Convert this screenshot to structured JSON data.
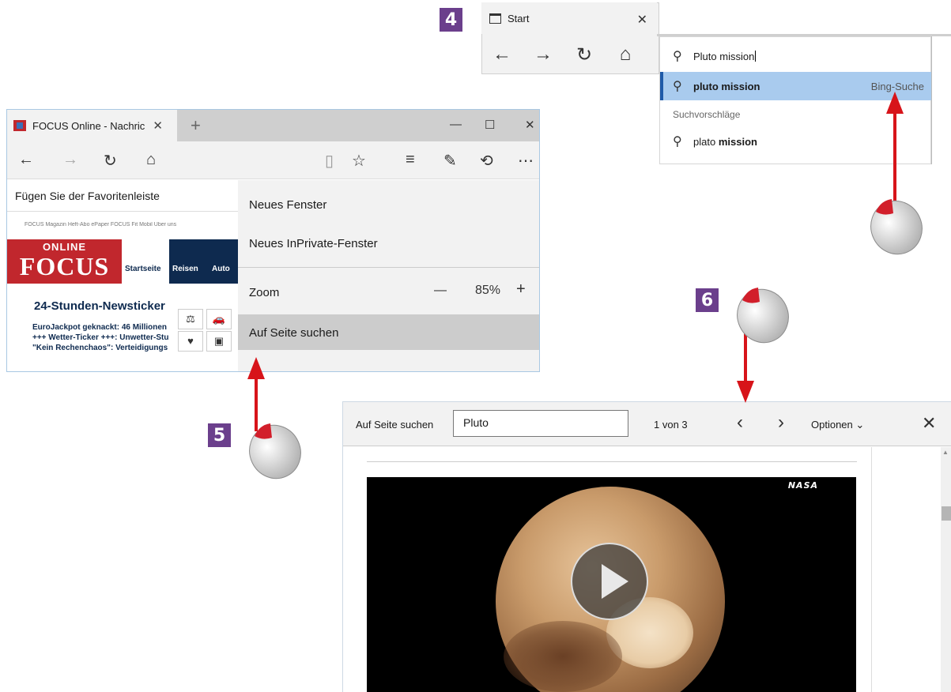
{
  "badges": {
    "step4": "4",
    "step5": "5",
    "step6": "6"
  },
  "panel4": {
    "tab_title": "Start",
    "input_value": "Pluto mission",
    "highlight_bold": "pluto mission",
    "highlight_engine": "Bing-Suche",
    "suggestions_label": "Suchvorschläge",
    "suggestion_prefix": "plato ",
    "suggestion_bold": "mission"
  },
  "focus_panel": {
    "tab_title": "FOCUS Online - Nachric",
    "favbar_text": "Fügen Sie der Favoritenleiste",
    "topnav": "FOCUS Magazin  Heft-Abo  ePaper  FOCUS Fit  Mobil  Über uns",
    "logo_online": "ONLINE",
    "logo_focus": "FOCUS",
    "navtab_start": "Startseite",
    "navtab_reisen": "Reisen",
    "navtab_auto": "Auto",
    "news_title": "24-Stunden-Newsticker",
    "news_lines": [
      "EuroJackpot geknackt: 46 Millionen",
      "+++ Wetter-Ticker +++: Unwetter-Stu",
      "\"Kein Rechenchaos\": Verteidigungs"
    ],
    "menu": {
      "new_window": "Neues Fenster",
      "new_private": "Neues InPrivate-Fenster",
      "zoom_label": "Zoom",
      "zoom_value": "85%",
      "find_on_page": "Auf Seite suchen"
    }
  },
  "findbar": {
    "label": "Auf Seite suchen",
    "input_value": "Pluto",
    "count": "1 von 3",
    "options": "Optionen",
    "video_logo": "NASA"
  },
  "colors": {
    "badge": "#6b3f8c",
    "arrow": "#d7141a",
    "highlight": "#a9cbee",
    "focus_red": "#c1272d",
    "focus_navy": "#0e2a4f"
  }
}
